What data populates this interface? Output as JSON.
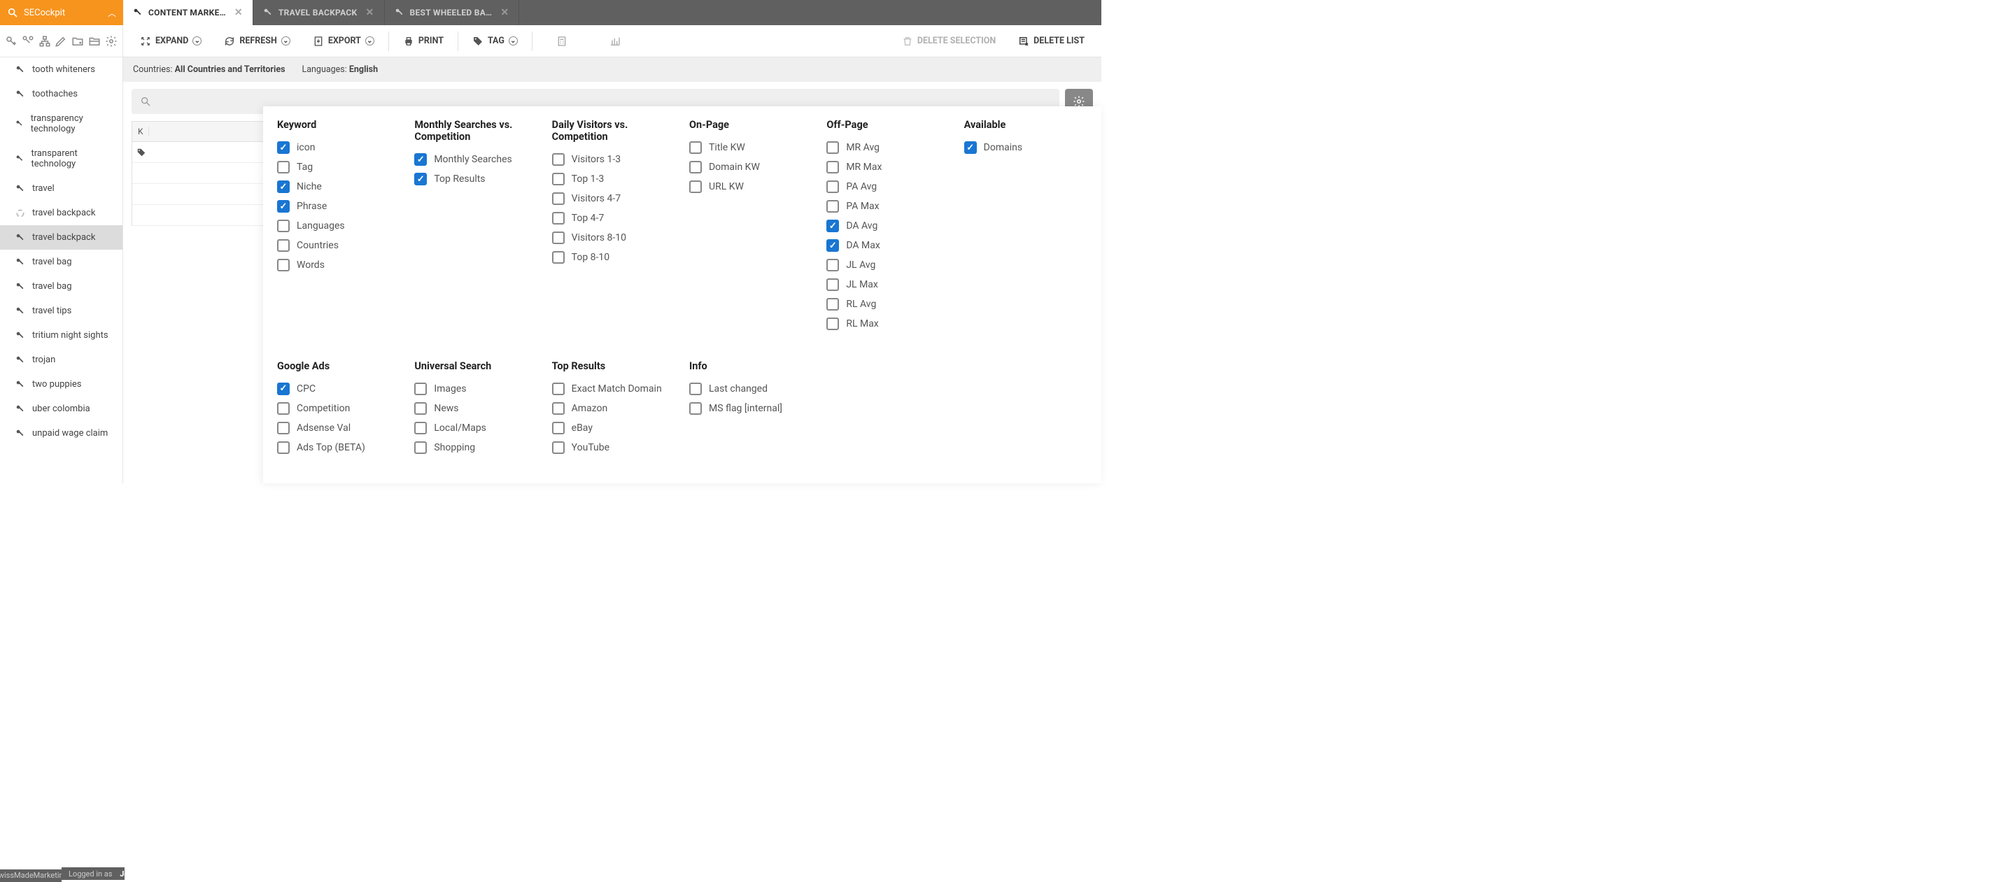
{
  "brand": {
    "name": "SECockpit"
  },
  "tabs": [
    {
      "label": "CONTENT MARKE…",
      "active": true,
      "icon": "key"
    },
    {
      "label": "TRAVEL BACKPACK",
      "active": false,
      "icon": "key"
    },
    {
      "label": "BEST WHEELED BA…",
      "active": false,
      "icon": "key"
    }
  ],
  "toolbar": {
    "expand": "EXPAND",
    "refresh": "REFRESH",
    "export": "EXPORT",
    "print": "PRINT",
    "tag": "TAG",
    "delete_selection": "DELETE SELECTION",
    "delete_list": "DELETE LIST"
  },
  "infobar": {
    "countries_label": "Countries:",
    "countries_value": "All Countries and Territories",
    "languages_label": "Languages:",
    "languages_value": "English"
  },
  "sidebar_items": [
    {
      "label": "tooth whiteners"
    },
    {
      "label": "toothaches"
    },
    {
      "label": "transparency technology"
    },
    {
      "label": "transparent technology"
    },
    {
      "label": "travel"
    },
    {
      "label": "travel backpack",
      "loading": true
    },
    {
      "label": "travel backpack",
      "active": true
    },
    {
      "label": "travel bag"
    },
    {
      "label": "travel bag"
    },
    {
      "label": "travel tips"
    },
    {
      "label": "tritium night sights"
    },
    {
      "label": "trojan"
    },
    {
      "label": "two puppies"
    },
    {
      "label": "uber colombia"
    },
    {
      "label": "unpaid wage claim"
    }
  ],
  "table": {
    "first_header": "K"
  },
  "panel": {
    "keyword": {
      "title": "Keyword",
      "items": [
        {
          "label": "icon",
          "checked": true
        },
        {
          "label": "Tag",
          "checked": false
        },
        {
          "label": "Niche",
          "checked": true
        },
        {
          "label": "Phrase",
          "checked": true
        },
        {
          "label": "Languages",
          "checked": false
        },
        {
          "label": "Countries",
          "checked": false
        },
        {
          "label": "Words",
          "checked": false
        }
      ]
    },
    "monthly": {
      "title": "Monthly Searches vs. Competition",
      "items": [
        {
          "label": "Monthly Searches",
          "checked": true
        },
        {
          "label": "Top Results",
          "checked": true
        }
      ]
    },
    "daily": {
      "title": "Daily Visitors vs. Competition",
      "items": [
        {
          "label": "Visitors 1-3",
          "checked": false
        },
        {
          "label": "Top 1-3",
          "checked": false
        },
        {
          "label": "Visitors 4-7",
          "checked": false
        },
        {
          "label": "Top 4-7",
          "checked": false
        },
        {
          "label": "Visitors 8-10",
          "checked": false
        },
        {
          "label": "Top 8-10",
          "checked": false
        }
      ]
    },
    "onpage": {
      "title": "On-Page",
      "items": [
        {
          "label": "Title KW",
          "checked": false
        },
        {
          "label": "Domain KW",
          "checked": false
        },
        {
          "label": "URL KW",
          "checked": false
        }
      ]
    },
    "offpage": {
      "title": "Off-Page",
      "items": [
        {
          "label": "MR Avg",
          "checked": false
        },
        {
          "label": "MR Max",
          "checked": false
        },
        {
          "label": "PA Avg",
          "checked": false
        },
        {
          "label": "PA Max",
          "checked": false
        },
        {
          "label": "DA Avg",
          "checked": true
        },
        {
          "label": "DA Max",
          "checked": true
        },
        {
          "label": "JL Avg",
          "checked": false
        },
        {
          "label": "JL Max",
          "checked": false
        },
        {
          "label": "RL Avg",
          "checked": false
        },
        {
          "label": "RL Max",
          "checked": false
        }
      ]
    },
    "available": {
      "title": "Available",
      "items": [
        {
          "label": "Domains",
          "checked": true
        }
      ]
    },
    "googleads": {
      "title": "Google Ads",
      "items": [
        {
          "label": "CPC",
          "checked": true
        },
        {
          "label": "Competition",
          "checked": false
        },
        {
          "label": "Adsense Val",
          "checked": false
        },
        {
          "label": "Ads Top (BETA)",
          "checked": false
        }
      ]
    },
    "universal": {
      "title": "Universal Search",
      "items": [
        {
          "label": "Images",
          "checked": false
        },
        {
          "label": "News",
          "checked": false
        },
        {
          "label": "Local/Maps",
          "checked": false
        },
        {
          "label": "Shopping",
          "checked": false
        }
      ]
    },
    "topresults": {
      "title": "Top Results",
      "items": [
        {
          "label": "Exact Match Domain",
          "checked": false
        },
        {
          "label": "Amazon",
          "checked": false
        },
        {
          "label": "eBay",
          "checked": false
        },
        {
          "label": "YouTube",
          "checked": false
        }
      ]
    },
    "info": {
      "title": "Info",
      "items": [
        {
          "label": "Last changed",
          "checked": false
        },
        {
          "label": "MS flag [internal]",
          "checked": false
        }
      ]
    }
  },
  "footer": {
    "company": "SwissMadeMarketing",
    "logged_in_label": "Logged in as",
    "user": "Jon Haver"
  }
}
